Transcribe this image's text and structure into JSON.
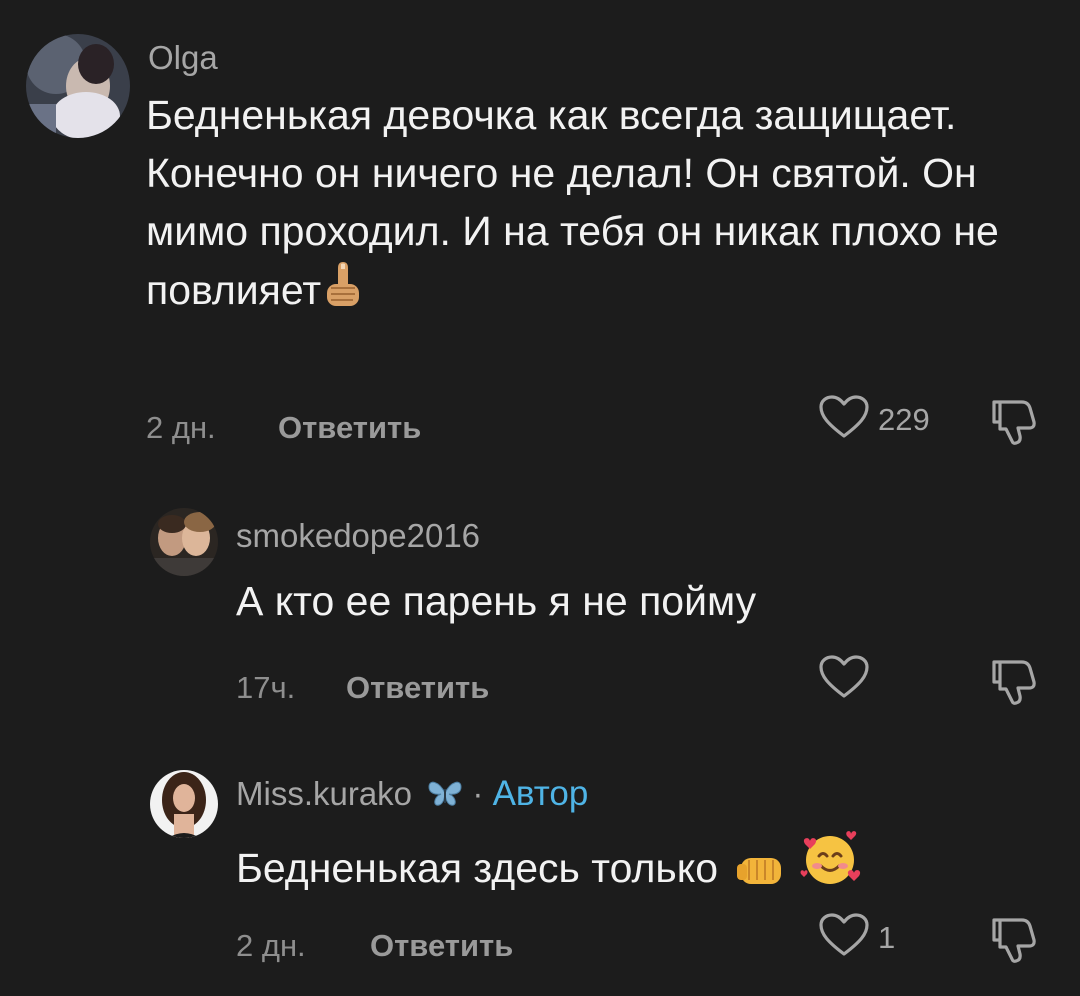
{
  "colors": {
    "background": "#1c1c1c",
    "username": "#a6a6a6",
    "text": "#f2f2f2",
    "meta": "#8e8e8e",
    "author_badge": "#4fb4e6"
  },
  "comments": [
    {
      "username": "Olga",
      "text": "Бедненькая девочка как всегда защищает. Конечно он ничего не делал! Он святой. Он мимо проходил. И на тебя он никак плохо не повлияет",
      "emoji": "pointing-up-emoji",
      "time": "2 дн.",
      "reply_label": "Ответить",
      "likes": "229"
    },
    {
      "username": "smokedope2016",
      "text": "А кто ее парень я не пойму",
      "time": "17ч.",
      "reply_label": "Ответить",
      "likes": ""
    },
    {
      "username": "Miss.kurako",
      "badge_icon": "butterfly-icon",
      "separator": "·",
      "author_label": "Автор",
      "text": "Бедненькая здесь только",
      "emoji": [
        "fist-bump-emoji",
        "smiling-face-with-hearts-emoji"
      ],
      "time": "2 дн.",
      "reply_label": "Ответить",
      "likes": "1"
    }
  ]
}
